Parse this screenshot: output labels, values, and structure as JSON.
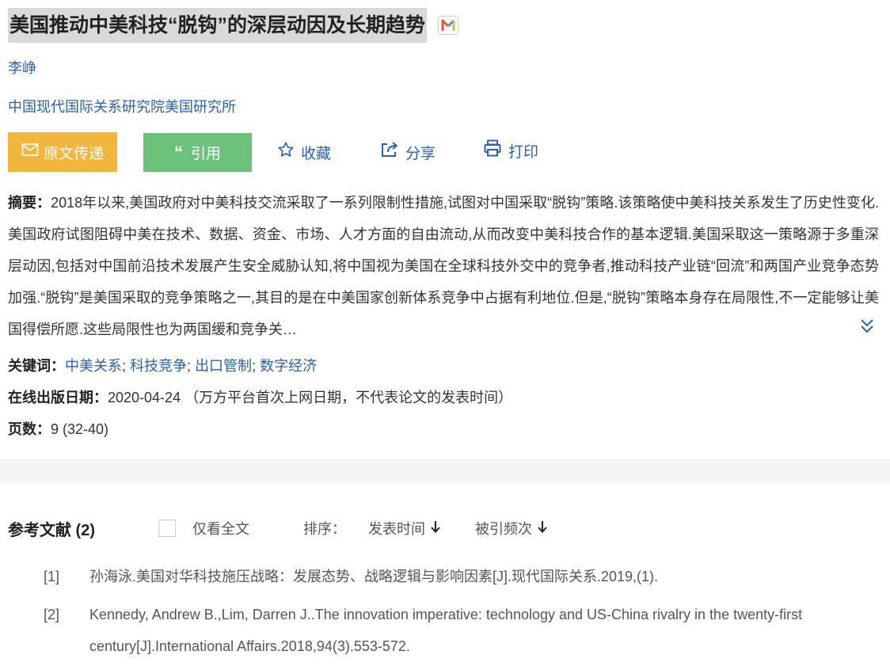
{
  "article": {
    "title": "美国推动中美科技“脱钩”的深层动因及长期趋势",
    "badge_icon": "m-multicolor-icon",
    "author": "李峥",
    "organization": "中国现代国际关系研究院美国研究所"
  },
  "actions": {
    "transfer_label": "原文传递",
    "cite_label": "引用",
    "favorite_label": "收藏",
    "share_label": "分享",
    "print_label": "打印"
  },
  "abstract": {
    "label": "摘要：",
    "text": "2018年以来,美国政府对中美科技交流采取了一系列限制性措施,试图对中国采取“脱钩”策略.该策略使中美科技关系发生了历史性变化.美国政府试图阻碍中美在技术、数据、资金、市场、人才方面的自由流动,从而改变中美科技合作的基本逻辑.美国采取这一策略源于多重深层动因,包括对中国前沿技术发展产生安全威胁认知,将中国视为美国在全球科技外交中的竞争者,推动科技产业链“回流”和两国产业竞争态势加强.“脱钩”是美国采取的竞争策略之一,其目的是在中美国家创新体系竞争中占据有利地位.但是,“脱钩”策略本身存在局限性,不一定能够让美国得偿所愿.这些局限性也为两国缓和竞争关…"
  },
  "keywords": {
    "label": "关键词：",
    "items": [
      "中美关系",
      "科技竞争",
      "出口管制",
      "数字经济"
    ],
    "separator": ";"
  },
  "publish": {
    "label": "在线出版日期：",
    "date": "2020-04-24",
    "note": "（万方平台首次上网日期，不代表论文的发表时间）"
  },
  "pages": {
    "label": "页数：",
    "value": "9 (32-40)"
  },
  "references": {
    "title": "参考文献 (2)",
    "only_full_label": "仅看全文",
    "sort_label": "排序：",
    "sort_options": [
      "发表时间",
      "被引频次"
    ],
    "items": [
      {
        "num": "[1]",
        "text": "孙海泳.美国对华科技施压战略：发展态势、战略逻辑与影响因素[J].现代国际关系.2019,(1)."
      },
      {
        "num": "[2]",
        "text": "Kennedy, Andrew B.,Lim, Darren J..The innovation imperative: technology and US-China rivalry in the twenty-first century[J].International Affairs.2018,94(3).553-572."
      }
    ]
  },
  "colors": {
    "link": "#2c60b5",
    "transfer_button": "#f2b63c",
    "cite_button": "#6cc27a",
    "title_highlight": "#d9d9d9"
  }
}
